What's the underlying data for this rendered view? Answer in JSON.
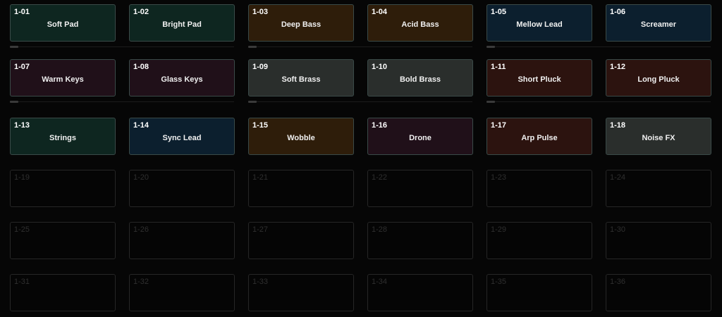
{
  "colors": {
    "teal": "#0e2620",
    "brown": "#2e1d0a",
    "navy": "#0c1f2e",
    "plum": "#201019",
    "slate": "#2a2e2c",
    "rust": "#2c130f",
    "empty": "#050505"
  },
  "slots": [
    {
      "num": "1-01",
      "name": "Soft Pad",
      "color": "teal"
    },
    {
      "num": "1-02",
      "name": "Bright Pad",
      "color": "teal"
    },
    {
      "num": "1-03",
      "name": "Deep Bass",
      "color": "brown"
    },
    {
      "num": "1-04",
      "name": "Acid Bass",
      "color": "brown"
    },
    {
      "num": "1-05",
      "name": "Mellow Lead",
      "color": "navy"
    },
    {
      "num": "1-06",
      "name": "Screamer",
      "color": "navy"
    },
    {
      "num": "1-07",
      "name": "Warm Keys",
      "color": "plum"
    },
    {
      "num": "1-08",
      "name": "Glass Keys",
      "color": "plum"
    },
    {
      "num": "1-09",
      "name": "Soft Brass",
      "color": "slate"
    },
    {
      "num": "1-10",
      "name": "Bold Brass",
      "color": "slate"
    },
    {
      "num": "1-11",
      "name": "Short Pluck",
      "color": "rust"
    },
    {
      "num": "1-12",
      "name": "Long Pluck",
      "color": "rust"
    },
    {
      "num": "1-13",
      "name": "Strings",
      "color": "teal"
    },
    {
      "num": "1-14",
      "name": "Sync Lead",
      "color": "navy"
    },
    {
      "num": "1-15",
      "name": "Wobble",
      "color": "brown"
    },
    {
      "num": "1-16",
      "name": "Drone",
      "color": "plum"
    },
    {
      "num": "1-17",
      "name": "Arp Pulse",
      "color": "rust"
    },
    {
      "num": "1-18",
      "name": "Noise FX",
      "color": "slate"
    },
    {
      "num": "1-19",
      "name": "",
      "color": "empty"
    },
    {
      "num": "1-20",
      "name": "",
      "color": "empty"
    },
    {
      "num": "1-21",
      "name": "",
      "color": "empty"
    },
    {
      "num": "1-22",
      "name": "",
      "color": "empty"
    },
    {
      "num": "1-23",
      "name": "",
      "color": "empty"
    },
    {
      "num": "1-24",
      "name": "",
      "color": "empty"
    },
    {
      "num": "1-25",
      "name": "",
      "color": "empty"
    },
    {
      "num": "1-26",
      "name": "",
      "color": "empty"
    },
    {
      "num": "1-27",
      "name": "",
      "color": "empty"
    },
    {
      "num": "1-28",
      "name": "",
      "color": "empty"
    },
    {
      "num": "1-29",
      "name": "",
      "color": "empty"
    },
    {
      "num": "1-30",
      "name": "",
      "color": "empty"
    },
    {
      "num": "1-31",
      "name": "",
      "color": "empty"
    },
    {
      "num": "1-32",
      "name": "",
      "color": "empty"
    },
    {
      "num": "1-33",
      "name": "",
      "color": "empty"
    },
    {
      "num": "1-34",
      "name": "",
      "color": "empty"
    },
    {
      "num": "1-35",
      "name": "",
      "color": "empty"
    },
    {
      "num": "1-36",
      "name": "",
      "color": "empty"
    }
  ]
}
